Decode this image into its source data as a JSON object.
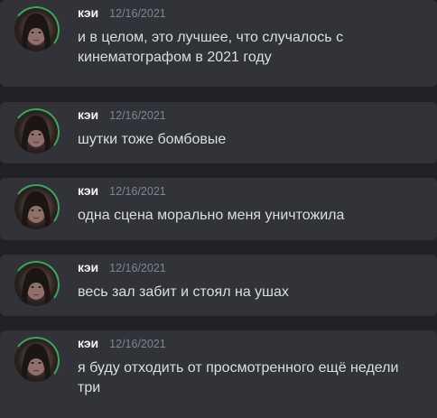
{
  "messages": [
    {
      "author": "кэи",
      "timestamp": "12/16/2021",
      "text": "и в целом, это лучшее, что случалось с кинематографом в 2021 году"
    },
    {
      "author": "кэи",
      "timestamp": "12/16/2021",
      "text": "шутки тоже бомбовые"
    },
    {
      "author": "кэи",
      "timestamp": "12/16/2021",
      "text": "одна сцена морально меня уничтожила"
    },
    {
      "author": "кэи",
      "timestamp": "12/16/2021",
      "text": "весь зал забит и стоял на ушах"
    },
    {
      "author": "кэи",
      "timestamp": "12/16/2021",
      "text": "я буду отходить от просмотренного ещё недели три"
    }
  ],
  "colors": {
    "background": "#202225",
    "message_background": "#313338",
    "author": "#f2f3f5",
    "timestamp": "#80848e",
    "text": "#dbdee1",
    "status_ring": "#3ba55d"
  }
}
